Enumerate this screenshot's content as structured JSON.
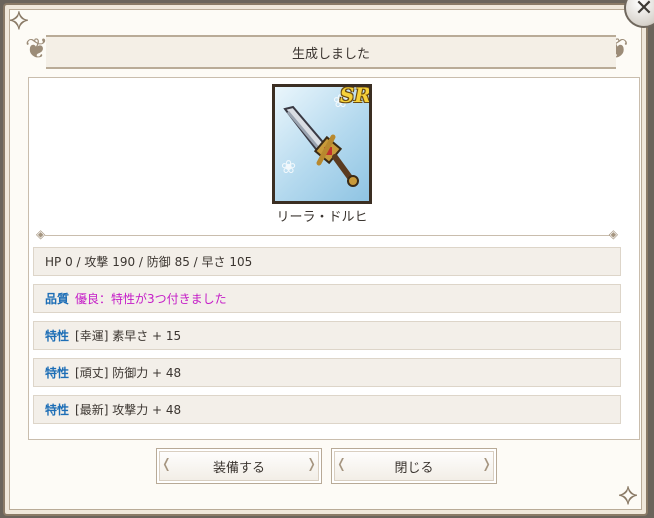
{
  "dialog": {
    "title": "生成しました",
    "close_symbol": "✕"
  },
  "item": {
    "name": "リーラ・ドルヒ",
    "rarity": "SR",
    "icon": "sword-icon"
  },
  "stats": "HP 0 / 攻撃 190 / 防御 85 / 早さ 105",
  "quality": {
    "tag": "品質",
    "text": "優良：特性が3つ付きました"
  },
  "traits": [
    {
      "tag": "特性",
      "text": "[幸運] 素早さ + 15"
    },
    {
      "tag": "特性",
      "text": "[頑丈] 防御力 + 48"
    },
    {
      "tag": "特性",
      "text": "[最新] 攻撃力 + 48"
    }
  ],
  "buttons": {
    "equip": "装備する",
    "close": "閉じる"
  },
  "colors": {
    "trait_tag": "#1d6eb6",
    "quality_text": "#c41cc7",
    "rarity": "#f6d23b"
  }
}
